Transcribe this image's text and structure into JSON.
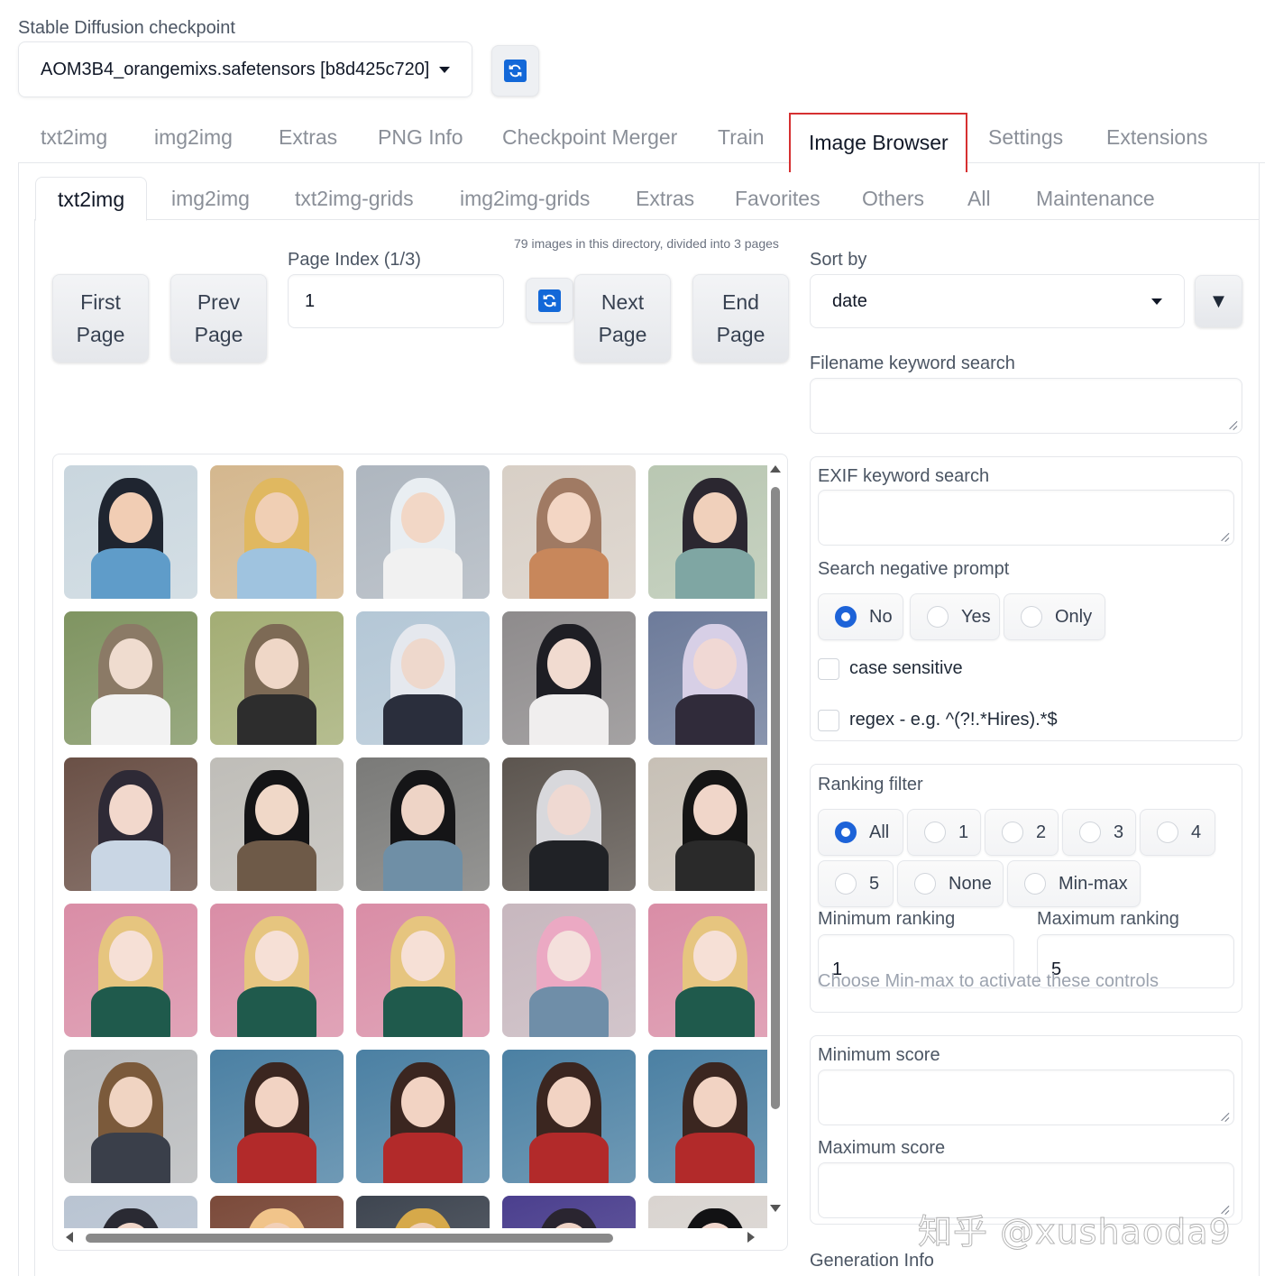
{
  "checkpoint": {
    "label": "Stable Diffusion checkpoint",
    "value": "AOM3B4_orangemixs.safetensors [b8d425c720]",
    "refresh_icon": "refresh-icon"
  },
  "main_tabs": [
    "txt2img",
    "img2img",
    "Extras",
    "PNG Info",
    "Checkpoint Merger",
    "Train",
    "Image Browser",
    "Settings",
    "Extensions"
  ],
  "main_tab_active": "Image Browser",
  "sub_tabs": [
    "txt2img",
    "img2img",
    "txt2img-grids",
    "img2img-grids",
    "Extras",
    "Favorites",
    "Others",
    "All",
    "Maintenance"
  ],
  "sub_tab_active": "txt2img",
  "browser": {
    "dir_info": "79 images in this directory, divided into 3 pages",
    "first_page": [
      "First",
      "Page"
    ],
    "prev_page": [
      "Prev",
      "Page"
    ],
    "next_page": [
      "Next",
      "Page"
    ],
    "end_page": [
      "End",
      "Page"
    ],
    "page_index_label": "Page Index (1/3)",
    "page_index_value": "1"
  },
  "sort": {
    "label": "Sort by",
    "value": "date",
    "direction_icon": "▼"
  },
  "filename_search": {
    "label": "Filename keyword search",
    "value": ""
  },
  "exif_search": {
    "label": "EXIF keyword search",
    "value": ""
  },
  "negative_prompt": {
    "label": "Search negative prompt",
    "options": [
      "No",
      "Yes",
      "Only"
    ],
    "selected": "No"
  },
  "case_sensitive": {
    "label": "case sensitive",
    "checked": false
  },
  "regex": {
    "label": "regex - e.g. ^(?!.*Hires).*$",
    "checked": false
  },
  "ranking": {
    "label": "Ranking filter",
    "options": [
      "All",
      "1",
      "2",
      "3",
      "4",
      "5",
      "None",
      "Min-max"
    ],
    "selected": "All",
    "min_label": "Minimum ranking",
    "min_value": "1",
    "max_label": "Maximum ranking",
    "max_value": "5",
    "hint": "Choose Min-max to activate these controls"
  },
  "score": {
    "min_label": "Minimum score",
    "max_label": "Maximum score"
  },
  "generation_info_label": "Generation Info",
  "watermark": "知乎 @xushaoda9",
  "gallery_thumbs": [
    {
      "bg": "#c9d6de",
      "hair": "#1f2530",
      "skin": "#f1cdb4",
      "cloth": "#5f9cc9"
    },
    {
      "bg": "#d4b78e",
      "hair": "#e0b860",
      "skin": "#f0cfb4",
      "cloth": "#9fc3df"
    },
    {
      "bg": "#aeb6bf",
      "hair": "#e9eef2",
      "skin": "#f2d7c6",
      "cloth": "#f1f1f1"
    },
    {
      "bg": "#d8cfc6",
      "hair": "#a07a63",
      "skin": "#f3d6c4",
      "cloth": "#c8875b"
    },
    {
      "bg": "#b9c7b2",
      "hair": "#2b2730",
      "skin": "#f0d0bb",
      "cloth": "#7fa6a3"
    },
    {
      "bg": "#7f9461",
      "hair": "#8b7a66",
      "skin": "#efdccf",
      "cloth": "#f2f2f2"
    },
    {
      "bg": "#a3ad74",
      "hair": "#7d6a55",
      "skin": "#efd7c7",
      "cloth": "#2d2d2d"
    },
    {
      "bg": "#b4c7d6",
      "hair": "#e5e8ee",
      "skin": "#eed8cc",
      "cloth": "#2a2e3c"
    },
    {
      "bg": "#8e8b8c",
      "hair": "#1e1e24",
      "skin": "#f1dbd0",
      "cloth": "#f0eeee"
    },
    {
      "bg": "#6d7b9a",
      "hair": "#d7cfe6",
      "skin": "#f0d8d4",
      "cloth": "#302b3a"
    },
    {
      "bg": "#6a5046",
      "hair": "#2e2a36",
      "skin": "#f2d8cc",
      "cloth": "#c9d6e4"
    },
    {
      "bg": "#bfbdb8",
      "hair": "#141416",
      "skin": "#f0d8c8",
      "cloth": "#6e5a48"
    },
    {
      "bg": "#7a7a78",
      "hair": "#151517",
      "skin": "#eed4c6",
      "cloth": "#6f8fa6"
    },
    {
      "bg": "#5c554f",
      "hair": "#d8d8dc",
      "skin": "#efd9d2",
      "cloth": "#202226"
    },
    {
      "bg": "#c7c0b6",
      "hair": "#151515",
      "skin": "#f0d6c9",
      "cloth": "#2a2a2a"
    },
    {
      "bg": "#d98da6",
      "hair": "#e6c57f",
      "skin": "#f6e0d6",
      "cloth": "#1f5a4c"
    },
    {
      "bg": "#d98da6",
      "hair": "#e6c57f",
      "skin": "#f6e0d6",
      "cloth": "#1f5a4c"
    },
    {
      "bg": "#d98da6",
      "hair": "#e6c57f",
      "skin": "#f6e0d6",
      "cloth": "#1f5a4c"
    },
    {
      "bg": "#c7b7be",
      "hair": "#eba9c3",
      "skin": "#f4e0dc",
      "cloth": "#6f8ea8"
    },
    {
      "bg": "#d98da6",
      "hair": "#e6c57f",
      "skin": "#f6e0d6",
      "cloth": "#1f5a4c"
    },
    {
      "bg": "#b7b9bb",
      "hair": "#7b5a3b",
      "skin": "#f0d4c2",
      "cloth": "#3a3f4a"
    },
    {
      "bg": "#4b80a3",
      "hair": "#3b2620",
      "skin": "#f2d3c3",
      "cloth": "#b22a2a"
    },
    {
      "bg": "#4b80a3",
      "hair": "#3b2620",
      "skin": "#f2d3c3",
      "cloth": "#b22a2a"
    },
    {
      "bg": "#4b80a3",
      "hair": "#3b2620",
      "skin": "#f2d3c3",
      "cloth": "#b22a2a"
    },
    {
      "bg": "#4b80a3",
      "hair": "#3b2620",
      "skin": "#f2d3c3",
      "cloth": "#b22a2a"
    },
    {
      "bg": "#b9c4d2",
      "hair": "#2a2a33",
      "skin": "#f0d6c9",
      "cloth": "#d9dde4"
    },
    {
      "bg": "#7b4a3a",
      "hair": "#f1c48a",
      "skin": "#f2d0b8",
      "cloth": "#5a3024"
    },
    {
      "bg": "#3e4550",
      "hair": "#d6a94a",
      "skin": "#f0d0b8",
      "cloth": "#333a44"
    },
    {
      "bg": "#4b3f8e",
      "hair": "#2a2530",
      "skin": "#efd3c6",
      "cloth": "#6a5ab5"
    },
    {
      "bg": "#d9d4d0",
      "hair": "#121214",
      "skin": "#f0d6cc",
      "cloth": "#e8e2de"
    }
  ]
}
